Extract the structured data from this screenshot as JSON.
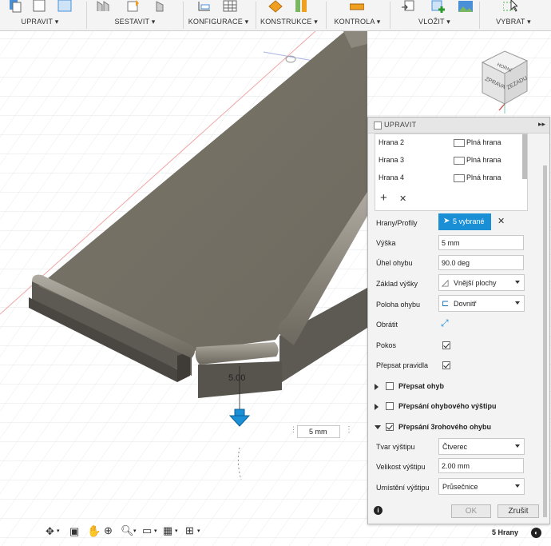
{
  "toolbar": {
    "groups": [
      {
        "label": "UPRAVIT ▾"
      },
      {
        "label": "SESTAVIT ▾"
      },
      {
        "label": "KONFIGURACE ▾"
      },
      {
        "label": "KONSTRUKCE ▾"
      },
      {
        "label": "KONTROLA ▾"
      },
      {
        "label": "VLOŽIT ▾"
      },
      {
        "label": "VYBRAT ▾"
      }
    ]
  },
  "viewcube": {
    "face_top": "HORNÍ",
    "face_front": "ZPRAVA",
    "face_right": "ZEZADU"
  },
  "viewport": {
    "dimension_label": "5.00",
    "distance_input": "5 mm",
    "selection_count": "5 Hrany"
  },
  "panel": {
    "title": "UPRAVIT",
    "edges": [
      {
        "name": "Hrana 2",
        "type": "Plná hrana"
      },
      {
        "name": "Hrana 3",
        "type": "Plná hrana"
      },
      {
        "name": "Hrana 4",
        "type": "Plná hrana"
      }
    ],
    "add_symbol": "+",
    "remove_symbol": "✕",
    "labels": {
      "edges_profiles": "Hrany/Profily",
      "height": "Výška",
      "bend_angle": "Úhel ohybu",
      "height_base": "Základ výšky",
      "bend_position": "Poloha ohybu",
      "flip": "Obrátit",
      "miter": "Pokos",
      "override_rules": "Přepsat pravidla",
      "relief_shape": "Tvar výštipu",
      "relief_size": "Velikost výštipu",
      "relief_placement": "Umístění výštipu"
    },
    "selection_button": "5 vybrané",
    "values": {
      "height": "5 mm",
      "bend_angle": "90.0 deg",
      "height_base": "Vnější plochy",
      "bend_position": "Dovnitř",
      "relief_shape": "Čtverec",
      "relief_size": "2.00 mm",
      "relief_placement": "Průsečnice"
    },
    "sections": {
      "override_bend": "Přepsat ohyb",
      "override_bend_relief": "Přepsání ohybového výštipu",
      "override_corner": "Přepsání 3rohového ohybu"
    },
    "ok": "OK",
    "cancel": "Zrušit",
    "info_symbol": "i"
  },
  "colors": {
    "accent": "#1a8fd6",
    "model": "#7d786f",
    "model_dark": "#5f5a53",
    "grid": "#d9dde3"
  }
}
